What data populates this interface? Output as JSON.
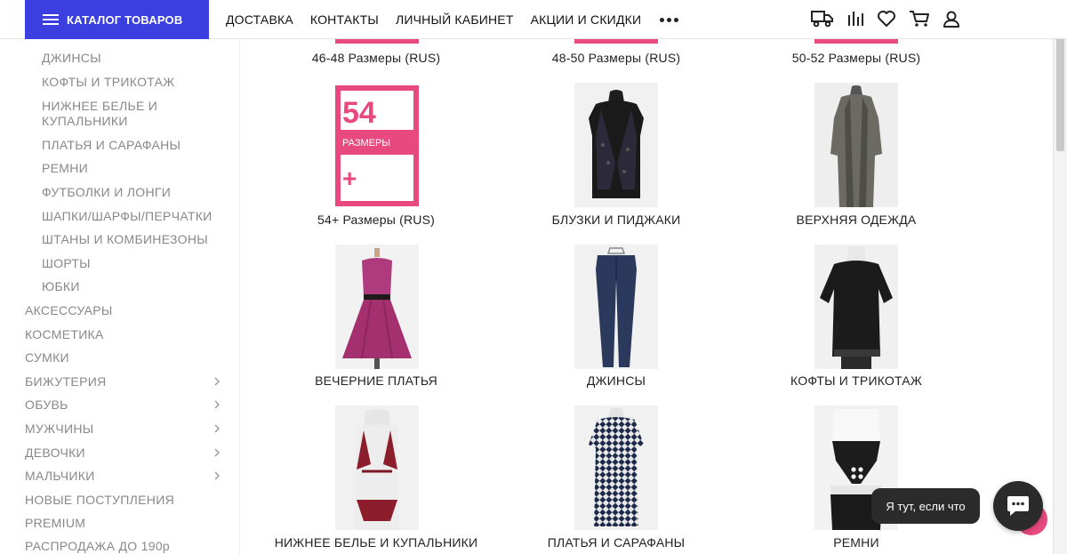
{
  "header": {
    "catalog_label": "КАТАЛОГ ТОВАРОВ",
    "nav": [
      "ДОСТАВКА",
      "КОНТАКТЫ",
      "ЛИЧНЫЙ КАБИНЕТ",
      "АКЦИИ И СКИДКИ"
    ],
    "icons": [
      "truck-icon",
      "compare-icon",
      "heart-icon",
      "cart-icon",
      "user-icon"
    ]
  },
  "sidebar": {
    "subitems": [
      "ДЖИНСЫ",
      "КОФТЫ И ТРИКОТАЖ",
      "НИЖНЕЕ БЕЛЬЕ И",
      "КУПАЛЬНИКИ",
      "ПЛАТЬЯ И САРАФАНЫ",
      "РЕМНИ",
      "ФУТБОЛКИ И ЛОНГИ",
      "ШАПКИ/ШАРФЫ/ПЕРЧАТКИ",
      "ШТАНЫ И КОМБИНЕЗОНЫ",
      "ШОРТЫ",
      "ЮБКИ"
    ],
    "items": [
      {
        "label": "АКСЕССУАРЫ",
        "chevron": false
      },
      {
        "label": "КОСМЕТИКА",
        "chevron": false
      },
      {
        "label": "СУМКИ",
        "chevron": false
      },
      {
        "label": "БИЖУТЕРИЯ",
        "chevron": true
      },
      {
        "label": "ОБУВЬ",
        "chevron": true
      },
      {
        "label": "МУЖЧИНЫ",
        "chevron": true
      },
      {
        "label": "ДЕВОЧКИ",
        "chevron": true
      },
      {
        "label": "МАЛЬЧИКИ",
        "chevron": true
      },
      {
        "label": "НОВЫЕ ПОСТУПЛЕНИЯ",
        "chevron": false
      },
      {
        "label": "PREMIUM",
        "chevron": false
      },
      {
        "label": "РАСПРОДАЖА ДО 190р",
        "chevron": false
      }
    ]
  },
  "grid": {
    "row0": [
      "46-48 Размеры (RUS)",
      "48-50 Размеры (RUS)",
      "50-52 Размеры (RUS)"
    ],
    "row1": [
      "54+ Размеры (RUS)",
      "БЛУЗКИ И ПИДЖАКИ",
      "ВЕРХНЯЯ ОДЕЖДА"
    ],
    "row2": [
      "ВЕЧЕРНИЕ ПЛАТЬЯ",
      "ДЖИНСЫ",
      "КОФТЫ И ТРИКОТАЖ"
    ],
    "row3": [
      "НИЖНЕЕ БЕЛЬЕ И КУПАЛЬНИКИ",
      "ПЛАТЬЯ И САРАФАНЫ",
      "РЕМНИ"
    ]
  },
  "size_card": {
    "number": "54",
    "word": "РАЗМЕРЫ",
    "plus": "+"
  },
  "chat": {
    "bubble_text": "Я тут, если что"
  },
  "colors": {
    "accent": "#3b3fe0",
    "pink": "#e84a7f"
  }
}
